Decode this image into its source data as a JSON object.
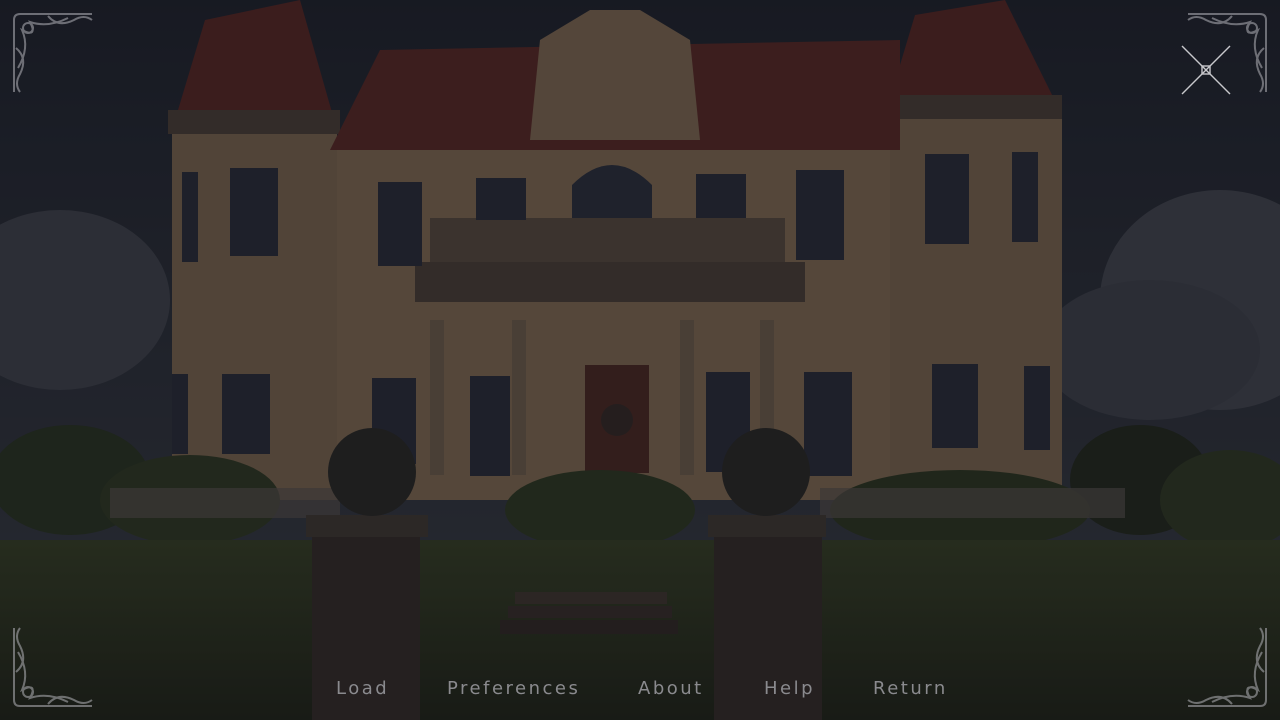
{
  "scene": {
    "background": "dimmed mansion scene",
    "sky_color": "#1e2430",
    "roof_color": "#7a2a22",
    "wall_color": "#b89a72",
    "lawn_color": "#2f3a1c"
  },
  "close_control": {
    "icon": "close-icon"
  },
  "quick_menu": {
    "items": [
      {
        "id": "load",
        "label": "Load"
      },
      {
        "id": "preferences",
        "label": "Preferences"
      },
      {
        "id": "about",
        "label": "About"
      },
      {
        "id": "help",
        "label": "Help"
      },
      {
        "id": "return",
        "label": "Return"
      }
    ],
    "text_color": "#8a8a8e"
  },
  "ornaments": {
    "icon": "flourish-corner-icon"
  }
}
